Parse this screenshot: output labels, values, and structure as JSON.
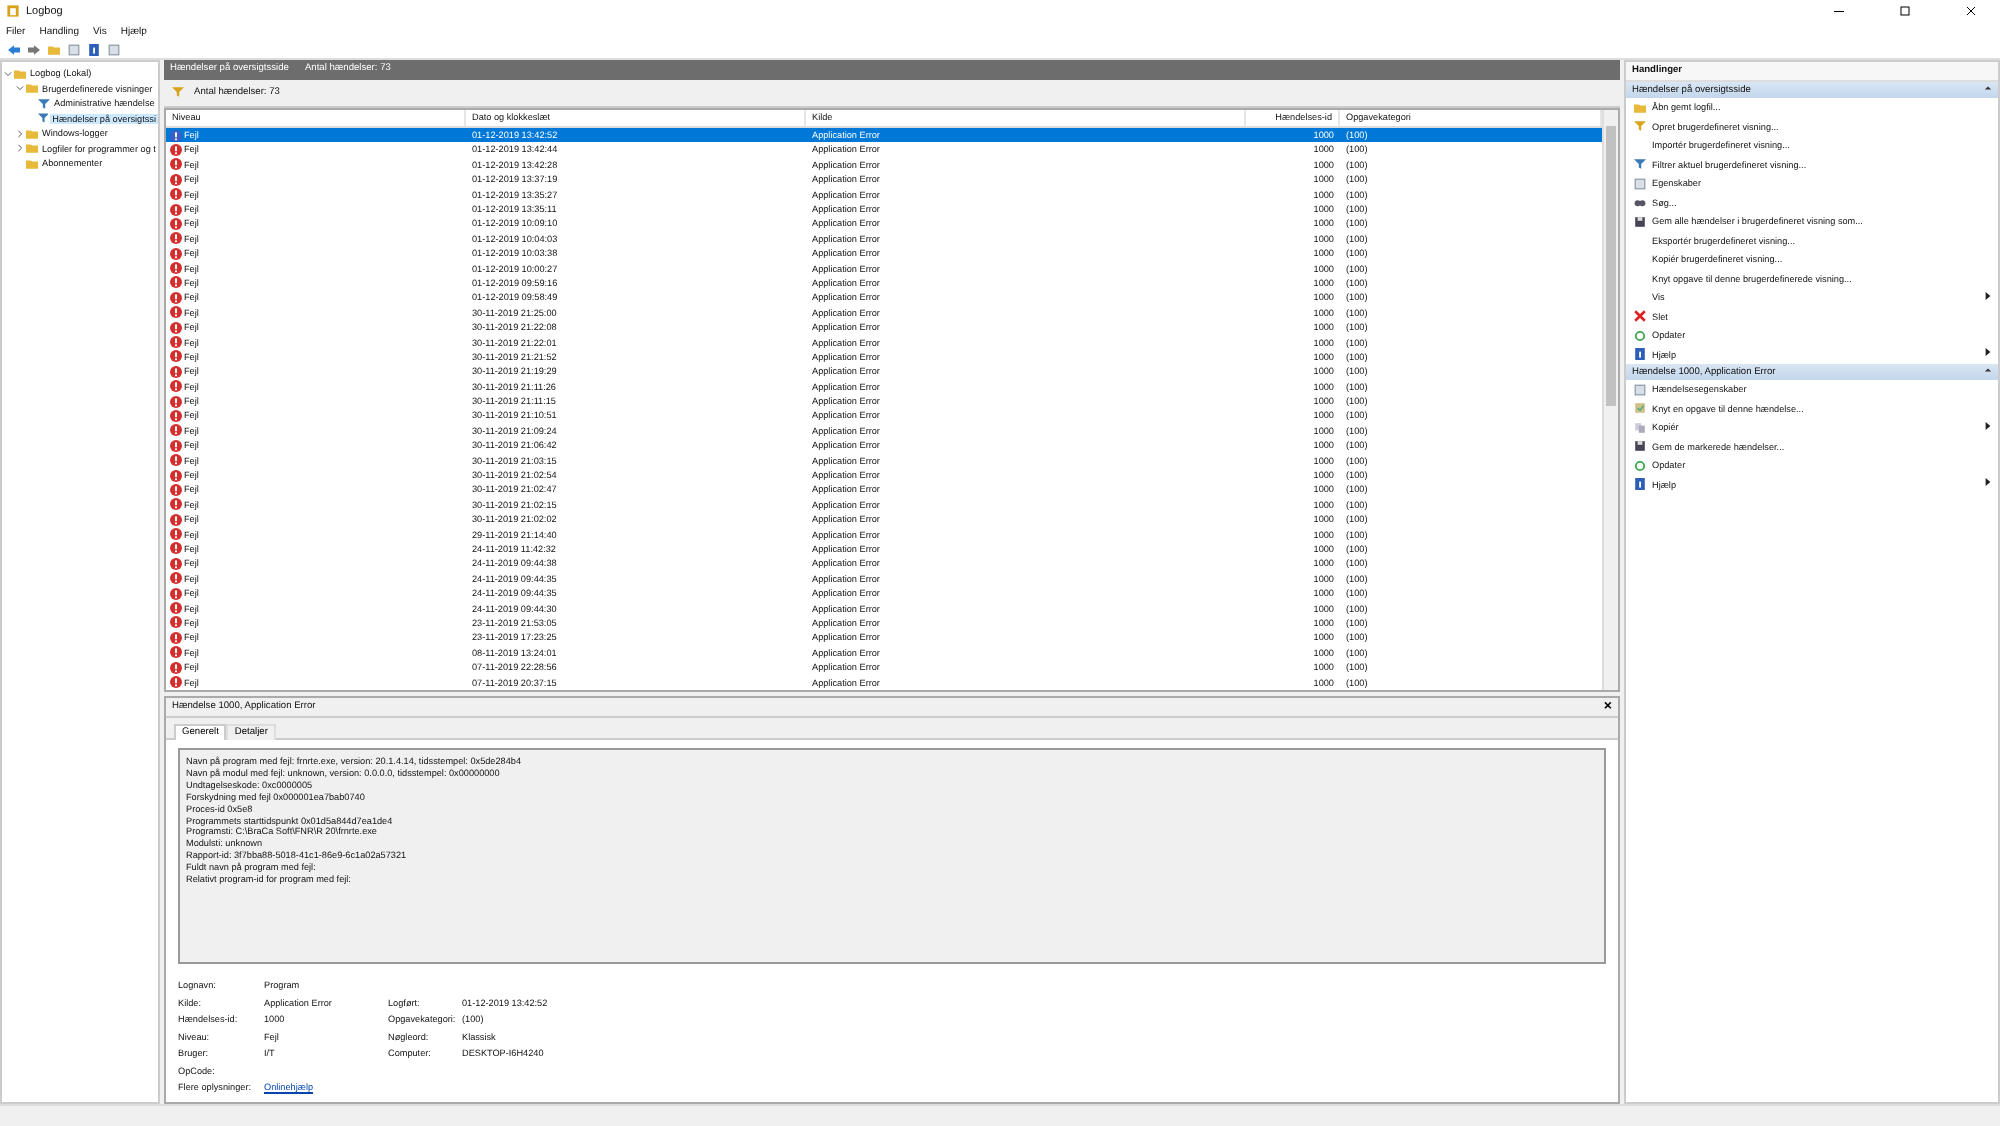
{
  "window": {
    "title": "Logbog"
  },
  "menu": [
    "Filer",
    "Handling",
    "Vis",
    "Hjælp"
  ],
  "tree": [
    {
      "label": "Logbog (Lokal)",
      "expanded": true,
      "selected": false,
      "children": [
        {
          "label": "Brugerdefinerede visninger",
          "expanded": true,
          "selected": false,
          "children": [
            {
              "label": "Administrative hændelse",
              "selected": false
            },
            {
              "label": "Hændelser på oversigtssi",
              "selected": true
            }
          ]
        },
        {
          "label": "Windows-logger",
          "expanded": false,
          "selected": false
        },
        {
          "label": "Logfiler for programmer og t",
          "expanded": false,
          "selected": false
        },
        {
          "label": "Abonnementer",
          "selected": false
        }
      ]
    }
  ],
  "panel_header": {
    "title": "Hændelser på oversigtsside",
    "count": "Antal hændelser: 73"
  },
  "filter_bar": {
    "text": "Antal hændelser: 73"
  },
  "table": {
    "columns": [
      "Niveau",
      "Dato og klokkeslæt",
      "Kilde",
      "Hændelses-id",
      "Opgavekategori"
    ],
    "rows": [
      {
        "level": "Fejl",
        "date": "01-12-2019 13:42:52",
        "source": "Application Error",
        "event_id": "1000",
        "category": "(100)",
        "selected": true
      },
      {
        "level": "Fejl",
        "date": "01-12-2019 13:42:44",
        "source": "Application Error",
        "event_id": "1000",
        "category": "(100)",
        "selected": false
      },
      {
        "level": "Fejl",
        "date": "01-12-2019 13:42:28",
        "source": "Application Error",
        "event_id": "1000",
        "category": "(100)",
        "selected": false
      },
      {
        "level": "Fejl",
        "date": "01-12-2019 13:37:19",
        "source": "Application Error",
        "event_id": "1000",
        "category": "(100)",
        "selected": false
      },
      {
        "level": "Fejl",
        "date": "01-12-2019 13:35:27",
        "source": "Application Error",
        "event_id": "1000",
        "category": "(100)",
        "selected": false
      },
      {
        "level": "Fejl",
        "date": "01-12-2019 13:35:11",
        "source": "Application Error",
        "event_id": "1000",
        "category": "(100)",
        "selected": false
      },
      {
        "level": "Fejl",
        "date": "01-12-2019 10:09:10",
        "source": "Application Error",
        "event_id": "1000",
        "category": "(100)",
        "selected": false
      },
      {
        "level": "Fejl",
        "date": "01-12-2019 10:04:03",
        "source": "Application Error",
        "event_id": "1000",
        "category": "(100)",
        "selected": false
      },
      {
        "level": "Fejl",
        "date": "01-12-2019 10:03:38",
        "source": "Application Error",
        "event_id": "1000",
        "category": "(100)",
        "selected": false
      },
      {
        "level": "Fejl",
        "date": "01-12-2019 10:00:27",
        "source": "Application Error",
        "event_id": "1000",
        "category": "(100)",
        "selected": false
      },
      {
        "level": "Fejl",
        "date": "01-12-2019 09:59:16",
        "source": "Application Error",
        "event_id": "1000",
        "category": "(100)",
        "selected": false
      },
      {
        "level": "Fejl",
        "date": "01-12-2019 09:58:49",
        "source": "Application Error",
        "event_id": "1000",
        "category": "(100)",
        "selected": false
      },
      {
        "level": "Fejl",
        "date": "30-11-2019 21:25:00",
        "source": "Application Error",
        "event_id": "1000",
        "category": "(100)",
        "selected": false
      },
      {
        "level": "Fejl",
        "date": "30-11-2019 21:22:08",
        "source": "Application Error",
        "event_id": "1000",
        "category": "(100)",
        "selected": false
      },
      {
        "level": "Fejl",
        "date": "30-11-2019 21:22:01",
        "source": "Application Error",
        "event_id": "1000",
        "category": "(100)",
        "selected": false
      },
      {
        "level": "Fejl",
        "date": "30-11-2019 21:21:52",
        "source": "Application Error",
        "event_id": "1000",
        "category": "(100)",
        "selected": false
      },
      {
        "level": "Fejl",
        "date": "30-11-2019 21:19:29",
        "source": "Application Error",
        "event_id": "1000",
        "category": "(100)",
        "selected": false
      },
      {
        "level": "Fejl",
        "date": "30-11-2019 21:11:26",
        "source": "Application Error",
        "event_id": "1000",
        "category": "(100)",
        "selected": false
      },
      {
        "level": "Fejl",
        "date": "30-11-2019 21:11:15",
        "source": "Application Error",
        "event_id": "1000",
        "category": "(100)",
        "selected": false
      },
      {
        "level": "Fejl",
        "date": "30-11-2019 21:10:51",
        "source": "Application Error",
        "event_id": "1000",
        "category": "(100)",
        "selected": false
      },
      {
        "level": "Fejl",
        "date": "30-11-2019 21:09:24",
        "source": "Application Error",
        "event_id": "1000",
        "category": "(100)",
        "selected": false
      },
      {
        "level": "Fejl",
        "date": "30-11-2019 21:06:42",
        "source": "Application Error",
        "event_id": "1000",
        "category": "(100)",
        "selected": false
      },
      {
        "level": "Fejl",
        "date": "30-11-2019 21:03:15",
        "source": "Application Error",
        "event_id": "1000",
        "category": "(100)",
        "selected": false
      },
      {
        "level": "Fejl",
        "date": "30-11-2019 21:02:54",
        "source": "Application Error",
        "event_id": "1000",
        "category": "(100)",
        "selected": false
      },
      {
        "level": "Fejl",
        "date": "30-11-2019 21:02:47",
        "source": "Application Error",
        "event_id": "1000",
        "category": "(100)",
        "selected": false
      },
      {
        "level": "Fejl",
        "date": "30-11-2019 21:02:15",
        "source": "Application Error",
        "event_id": "1000",
        "category": "(100)",
        "selected": false
      },
      {
        "level": "Fejl",
        "date": "30-11-2019 21:02:02",
        "source": "Application Error",
        "event_id": "1000",
        "category": "(100)",
        "selected": false
      },
      {
        "level": "Fejl",
        "date": "29-11-2019 21:14:40",
        "source": "Application Error",
        "event_id": "1000",
        "category": "(100)",
        "selected": false
      },
      {
        "level": "Fejl",
        "date": "24-11-2019 11:42:32",
        "source": "Application Error",
        "event_id": "1000",
        "category": "(100)",
        "selected": false
      },
      {
        "level": "Fejl",
        "date": "24-11-2019 09:44:38",
        "source": "Application Error",
        "event_id": "1000",
        "category": "(100)",
        "selected": false
      },
      {
        "level": "Fejl",
        "date": "24-11-2019 09:44:35",
        "source": "Application Error",
        "event_id": "1000",
        "category": "(100)",
        "selected": false
      },
      {
        "level": "Fejl",
        "date": "24-11-2019 09:44:35",
        "source": "Application Error",
        "event_id": "1000",
        "category": "(100)",
        "selected": false
      },
      {
        "level": "Fejl",
        "date": "24-11-2019 09:44:30",
        "source": "Application Error",
        "event_id": "1000",
        "category": "(100)",
        "selected": false
      },
      {
        "level": "Fejl",
        "date": "23-11-2019 21:53:05",
        "source": "Application Error",
        "event_id": "1000",
        "category": "(100)",
        "selected": false
      },
      {
        "level": "Fejl",
        "date": "23-11-2019 17:23:25",
        "source": "Application Error",
        "event_id": "1000",
        "category": "(100)",
        "selected": false
      },
      {
        "level": "Fejl",
        "date": "08-11-2019 13:24:01",
        "source": "Application Error",
        "event_id": "1000",
        "category": "(100)",
        "selected": false
      },
      {
        "level": "Fejl",
        "date": "07-11-2019 22:28:56",
        "source": "Application Error",
        "event_id": "1000",
        "category": "(100)",
        "selected": false
      },
      {
        "level": "Fejl",
        "date": "07-11-2019 20:37:15",
        "source": "Application Error",
        "event_id": "1000",
        "category": "(100)",
        "selected": false
      }
    ]
  },
  "details": {
    "title": "Hændelse 1000, Application Error",
    "close": "×",
    "tabs": [
      {
        "label": "Generelt",
        "selected": true
      },
      {
        "label": "Detaljer",
        "selected": false
      }
    ],
    "description": [
      "Navn på program med fejl: frnrte.exe, version: 20.1.4.14, tidsstempel: 0x5de284b4",
      "Navn på modul med fejl: unknown, version: 0.0.0.0, tidsstempel: 0x00000000",
      "Undtagelseskode: 0xc0000005",
      "Forskydning med fejl 0x000001ea7bab0740",
      "Proces-id 0x5e8",
      "Programmets starttidspunkt 0x01d5a844d7ea1de4",
      "Programsti: C:\\BraCa Soft\\FNR\\R 20\\frnrte.exe",
      "Modulsti: unknown",
      "Rapport-id: 3f7bba88-5018-41c1-86e9-6c1a02a57321",
      "Fuldt navn på program med fejl:",
      "Relativt program-id for program med fejl:"
    ],
    "fields": [
      [
        {
          "label": "Lognavn:",
          "value": "Program"
        }
      ],
      [
        {
          "label": "Kilde:",
          "value": "Application Error"
        },
        {
          "label": "Logført:",
          "value": "01-12-2019 13:42:52"
        }
      ],
      [
        {
          "label": "Hændelses-id:",
          "value": "1000"
        },
        {
          "label": "Opgavekategori:",
          "value": "(100)"
        }
      ],
      [
        {
          "label": "Niveau:",
          "value": "Fejl"
        },
        {
          "label": "Nøgleord:",
          "value": "Klassisk"
        }
      ],
      [
        {
          "label": "Bruger:",
          "value": "I/T"
        },
        {
          "label": "Computer:",
          "value": "DESKTOP-I6H4240"
        }
      ],
      [
        {
          "label": "OpCode:"
        }
      ],
      [
        {
          "label": "Flere oplysninger:",
          "link": "Onlinehjælp"
        }
      ]
    ]
  },
  "actions": {
    "title": "Handlinger",
    "sections": [
      {
        "title": "Hændelser på oversigtsside",
        "expanded": true,
        "items": [
          {
            "label": "Åbn gemt logfil...",
            "submenu": false
          },
          {
            "label": "Opret brugerdefineret visning...",
            "submenu": false
          },
          {
            "label": "Importér brugerdefineret visning...",
            "submenu": false
          },
          {
            "label": "Filtrer aktuel brugerdefineret visning...",
            "submenu": false
          },
          {
            "label": "Egenskaber",
            "submenu": false
          },
          {
            "label": "Søg...",
            "submenu": false
          },
          {
            "label": "Gem alle hændelser i brugerdefineret visning som...",
            "submenu": false
          },
          {
            "label": "Eksportér brugerdefineret visning...",
            "submenu": false
          },
          {
            "label": "Kopiér brugerdefineret visning...",
            "submenu": false
          },
          {
            "label": "Knyt opgave til denne brugerdefinerede visning...",
            "submenu": false
          },
          {
            "label": "Vis",
            "submenu": true
          },
          {
            "label": "Slet",
            "submenu": false
          },
          {
            "label": "Opdater",
            "submenu": false
          },
          {
            "label": "Hjælp",
            "submenu": true
          }
        ]
      },
      {
        "title": "Hændelse 1000, Application Error",
        "expanded": true,
        "items": [
          {
            "label": "Hændelsesegenskaber",
            "submenu": false
          },
          {
            "label": "Knyt en opgave til denne hændelse...",
            "submenu": false
          },
          {
            "label": "Kopiér",
            "submenu": true
          },
          {
            "label": "Gem de markerede hændelser...",
            "submenu": false
          },
          {
            "label": "Opdater",
            "submenu": false
          },
          {
            "label": "Hjælp",
            "submenu": true
          }
        ]
      }
    ]
  }
}
